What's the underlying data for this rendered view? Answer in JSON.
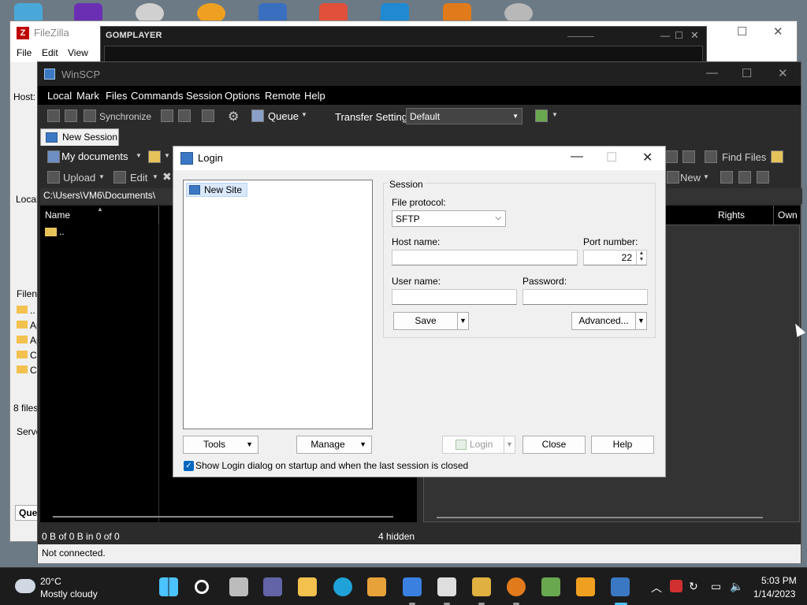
{
  "filezilla": {
    "title": "FileZilla",
    "menu": [
      "File",
      "Edit",
      "View"
    ],
    "host_label": "Host:",
    "local_label": "Local",
    "filename_label": "Filen",
    "file_items": [
      "..",
      "Ap",
      "Ap",
      "Co",
      "Co"
    ],
    "status": "8 files",
    "server_label": "Serve",
    "queue_label": "Que"
  },
  "gom": {
    "title": "GOMPLAYER"
  },
  "winscp": {
    "title": "WinSCP",
    "menu": [
      "Local",
      "Mark",
      "Files",
      "Commands",
      "Session",
      "Options",
      "Remote",
      "Help"
    ],
    "toolbar": {
      "synchronize": "Synchronize",
      "queue": "Queue",
      "transfer_settings_label": "Transfer Settings",
      "transfer_settings_value": "Default"
    },
    "tab_new_session": "New Session",
    "left_panel": {
      "location": "My documents",
      "upload": "Upload",
      "edit": "Edit",
      "path": "C:\\Users\\VM6\\Documents\\",
      "column_name": "Name",
      "parent_dir": ".."
    },
    "right_panel": {
      "find_files": "Find Files",
      "new": "New",
      "columns": [
        "Rights",
        "Own"
      ]
    },
    "status_transfer": "0 B of 0 B in 0 of 0",
    "status_hidden": "4 hidden",
    "status_connection": "Not connected."
  },
  "login": {
    "title": "Login",
    "site_tree": [
      "New Site"
    ],
    "session_legend": "Session",
    "file_protocol_label": "File protocol:",
    "file_protocol_value": "SFTP",
    "host_name_label": "Host name:",
    "host_name_value": "",
    "port_label": "Port number:",
    "port_value": "22",
    "user_name_label": "User name:",
    "user_name_value": "",
    "password_label": "Password:",
    "password_value": "",
    "save": "Save",
    "advanced": "Advanced...",
    "tools": "Tools",
    "manage": "Manage",
    "login_button": "Login",
    "close": "Close",
    "help": "Help",
    "startup_checkbox": "Show Login dialog on startup and when the last session is closed",
    "startup_checked": true
  },
  "taskbar": {
    "weather_temp": "20°C",
    "weather_desc": "Mostly cloudy",
    "apps": [
      "start-icon",
      "search-icon",
      "task-view-icon",
      "meet-icon",
      "file-explorer-icon",
      "edge-icon",
      "store-icon",
      "app-icon",
      "app-icon",
      "app-icon",
      "search-app-icon",
      "app-icon",
      "app-icon",
      "winscp-icon"
    ],
    "time": "5:03 PM",
    "date": "1/14/2023"
  },
  "colors": {
    "winscp_dark": "#2b2b2b",
    "accent": "#0067c0",
    "selection": "#d9e8fb"
  }
}
